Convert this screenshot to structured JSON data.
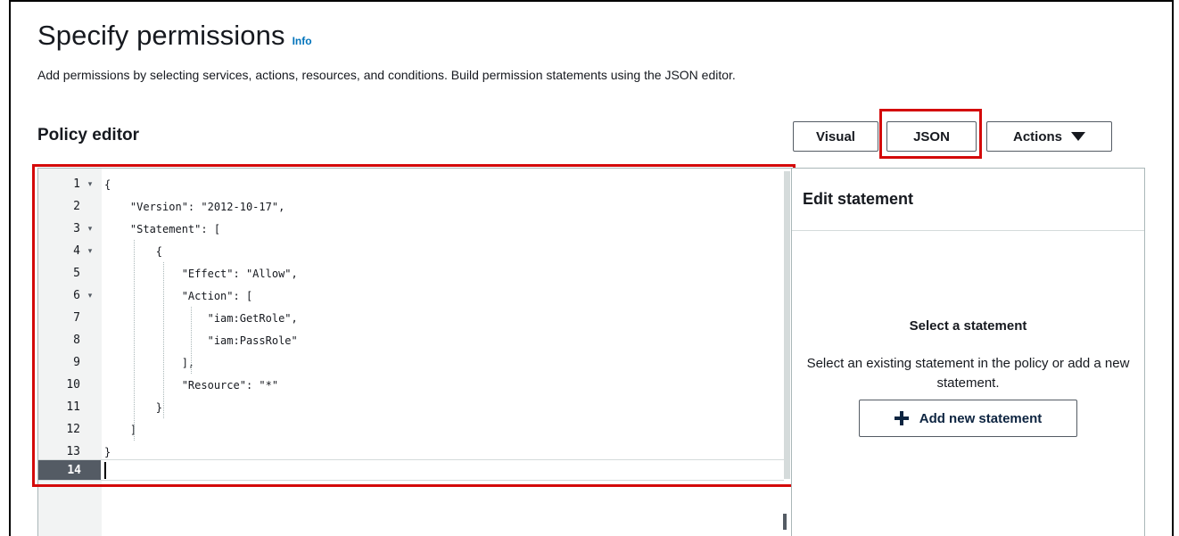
{
  "page": {
    "title": "Specify permissions",
    "info_label": "Info",
    "description": "Add permissions by selecting services, actions, resources, and conditions. Build permission statements using the JSON editor."
  },
  "policy_editor": {
    "heading": "Policy editor",
    "mode_buttons": {
      "visual": "Visual",
      "json": "JSON",
      "actions": "Actions"
    },
    "selected_mode": "JSON",
    "active_line": "14",
    "code_lines": [
      {
        "num": "1",
        "text": "{",
        "fold": true
      },
      {
        "num": "2",
        "text": "    \"Version\": \"2012-10-17\",",
        "fold": false
      },
      {
        "num": "3",
        "text": "    \"Statement\": [",
        "fold": true
      },
      {
        "num": "4",
        "text": "        {",
        "fold": true
      },
      {
        "num": "5",
        "text": "            \"Effect\": \"Allow\",",
        "fold": false
      },
      {
        "num": "6",
        "text": "            \"Action\": [",
        "fold": true
      },
      {
        "num": "7",
        "text": "                \"iam:GetRole\",",
        "fold": false
      },
      {
        "num": "8",
        "text": "                \"iam:PassRole\"",
        "fold": false
      },
      {
        "num": "9",
        "text": "            ],",
        "fold": false
      },
      {
        "num": "10",
        "text": "            \"Resource\": \"*\"",
        "fold": false
      },
      {
        "num": "11",
        "text": "        }",
        "fold": false
      },
      {
        "num": "12",
        "text": "    ]",
        "fold": false
      },
      {
        "num": "13",
        "text": "}",
        "fold": false
      }
    ]
  },
  "edit_statement": {
    "title": "Edit statement",
    "empty_title": "Select a statement",
    "empty_description": "Select an existing statement in the policy or add a new statement.",
    "add_button": "Add new statement"
  },
  "colors": {
    "highlight_red": "#d40a0a",
    "info_link": "#0073bb",
    "text": "#16191f"
  }
}
